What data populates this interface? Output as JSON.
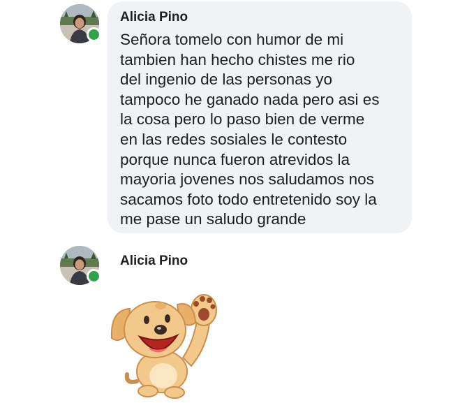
{
  "comments": [
    {
      "author": "Alicia Pino",
      "avatar": "profile-photo",
      "online": true,
      "text": "Señora tomelo con humor de mi\ntambien han hecho chistes  me rio\ndel ingenio de las personas yo\ntampoco he ganado nada pero asi es\nla cosa pero lo paso bien de verme\nen las redes sosiales le contesto\nporque nunca fueron atrevidos la\nmayoria jovenes nos saludamos nos\nsacamos foto todo entretenido soy la\nme pase un saludo grande"
    },
    {
      "author": "Alicia Pino",
      "avatar": "profile-photo",
      "online": true,
      "sticker": "waving-puppy-sticker"
    }
  ],
  "colors": {
    "bubble": "#f0f2f5",
    "online": "#31a24c",
    "text": "#1c1e21"
  }
}
